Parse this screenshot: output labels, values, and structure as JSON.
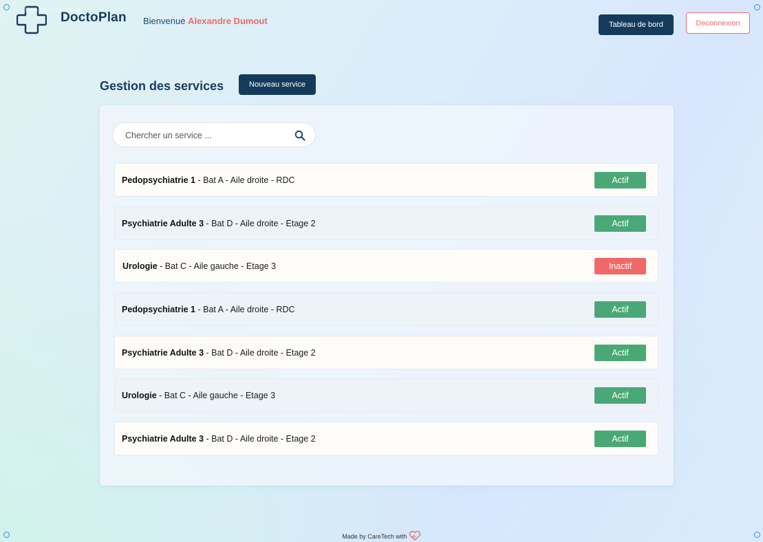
{
  "header": {
    "logo_alt": "logo de l'utilisateur",
    "brand": "DoctoPlan",
    "welcome_prefix": "Bienvenue",
    "user_name": "Alexandre Dumout",
    "dashboard_label": "Tableau de bord",
    "logout_label": "Deconnexion"
  },
  "page": {
    "title": "Gestion des services",
    "new_service_label": "Nouveau service"
  },
  "search": {
    "placeholder": "Chercher un service ..."
  },
  "services": [
    {
      "name": "Pedopsychiatrie 1",
      "details": " - Bat A - Aile droite - RDC",
      "status": "Actif"
    },
    {
      "name": "Psychiatrie Adulte 3",
      "details": " - Bat D - Aile droite - Etage 2",
      "status": "Actif"
    },
    {
      "name": "Urologie",
      "details": " - Bat C - Aile gauche - Etage 3",
      "status": "Inactif"
    },
    {
      "name": "Pedopsychiatrie 1",
      "details": " - Bat A - Aile droite - RDC",
      "status": "Actif"
    },
    {
      "name": "Psychiatrie Adulte 3",
      "details": " - Bat D - Aile droite - Etage 2",
      "status": "Actif"
    },
    {
      "name": "Urologie",
      "details": " - Bat C - Aile gauche - Etage 3",
      "status": "Actif"
    },
    {
      "name": "Psychiatrie Adulte 3",
      "details": " - Bat D - Aile droite - Etage 2",
      "status": "Actif"
    }
  ],
  "footer": {
    "text": "Made by CareTech with"
  },
  "colors": {
    "brand_dark": "#153b5c",
    "accent_red": "#ef6c6c",
    "status_active": "#4aa877",
    "status_inactive": "#f26767"
  },
  "icons": {
    "logo": "medical-cross-icon",
    "search": "search-icon",
    "footer": "heart-icon"
  }
}
